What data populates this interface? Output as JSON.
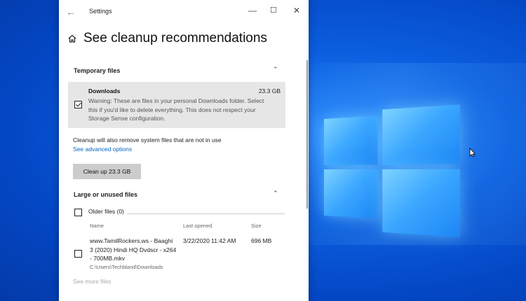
{
  "window": {
    "title": "Settings"
  },
  "page": {
    "title": "See cleanup recommendations"
  },
  "temporary_files": {
    "heading": "Temporary files",
    "downloads": {
      "name": "Downloads",
      "size": "23.3 GB",
      "checked": true,
      "warning": "Warning: These are files in your personal Downloads folder. Select this if you'd like to delete everything. This does not respect your Storage Sense configuration."
    },
    "note": "Cleanup will also remove system files that are not in use",
    "advanced_link": "See advanced options",
    "cleanup_button": "Clean up 23.3 GB"
  },
  "large_files": {
    "heading": "Large or unused files",
    "older_files_label": "Older files (0)",
    "columns": [
      "Name",
      "Last opened",
      "Size"
    ],
    "rows": [
      {
        "name": "www.TamilRockers.ws - Baaghi 3 (2020) Hindi HQ Dvdscr - x264 - 700MB.mkv",
        "path": "C:\\Users\\Techbland\\Downloads",
        "last_opened": "3/22/2020 11:42 AM",
        "size": "696 MB",
        "checked": false
      }
    ],
    "see_more": "See more files"
  },
  "colors": {
    "link": "#0067c0",
    "desktop": "#0b5fe0",
    "button": "#cccccc"
  }
}
